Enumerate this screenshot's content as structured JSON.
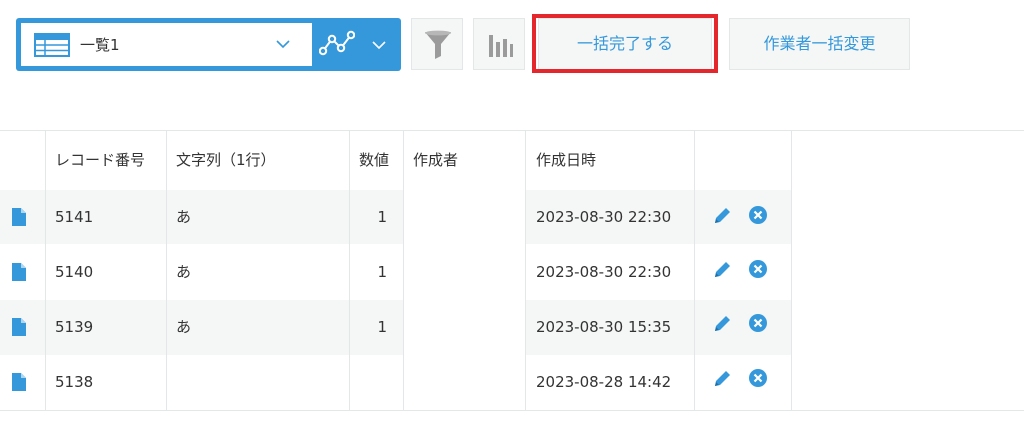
{
  "toolbar": {
    "view_name": "一覧1",
    "icons": {
      "view": "table-list-icon",
      "graph": "line-graph-icon",
      "filter": "funnel-icon",
      "aggregate": "bar-chart-icon"
    },
    "bulk_complete_label": "一括完了する",
    "bulk_change_assignee_label": "作業者一括変更",
    "highlight_color": "#e3272d"
  },
  "colors": {
    "accent": "#3498db",
    "button_bg": "#f5f6f6",
    "border": "#e3e7e8"
  },
  "table": {
    "headers": {
      "record_no": "レコード番号",
      "text": "文字列（1行）",
      "number": "数値",
      "creator": "作成者",
      "created_at": "作成日時"
    },
    "rows": [
      {
        "record_no": "5141",
        "text": "あ",
        "number": "1",
        "creator": "",
        "created_at": "2023-08-30 22:30"
      },
      {
        "record_no": "5140",
        "text": "あ",
        "number": "1",
        "creator": "",
        "created_at": "2023-08-30 22:30"
      },
      {
        "record_no": "5139",
        "text": "あ",
        "number": "1",
        "creator": "",
        "created_at": "2023-08-30 15:35"
      },
      {
        "record_no": "5138",
        "text": "",
        "number": "",
        "creator": "",
        "created_at": "2023-08-28 14:42"
      }
    ],
    "row_icons": {
      "detail": "document-icon",
      "edit": "pencil-icon",
      "delete": "close-circle-icon"
    }
  }
}
